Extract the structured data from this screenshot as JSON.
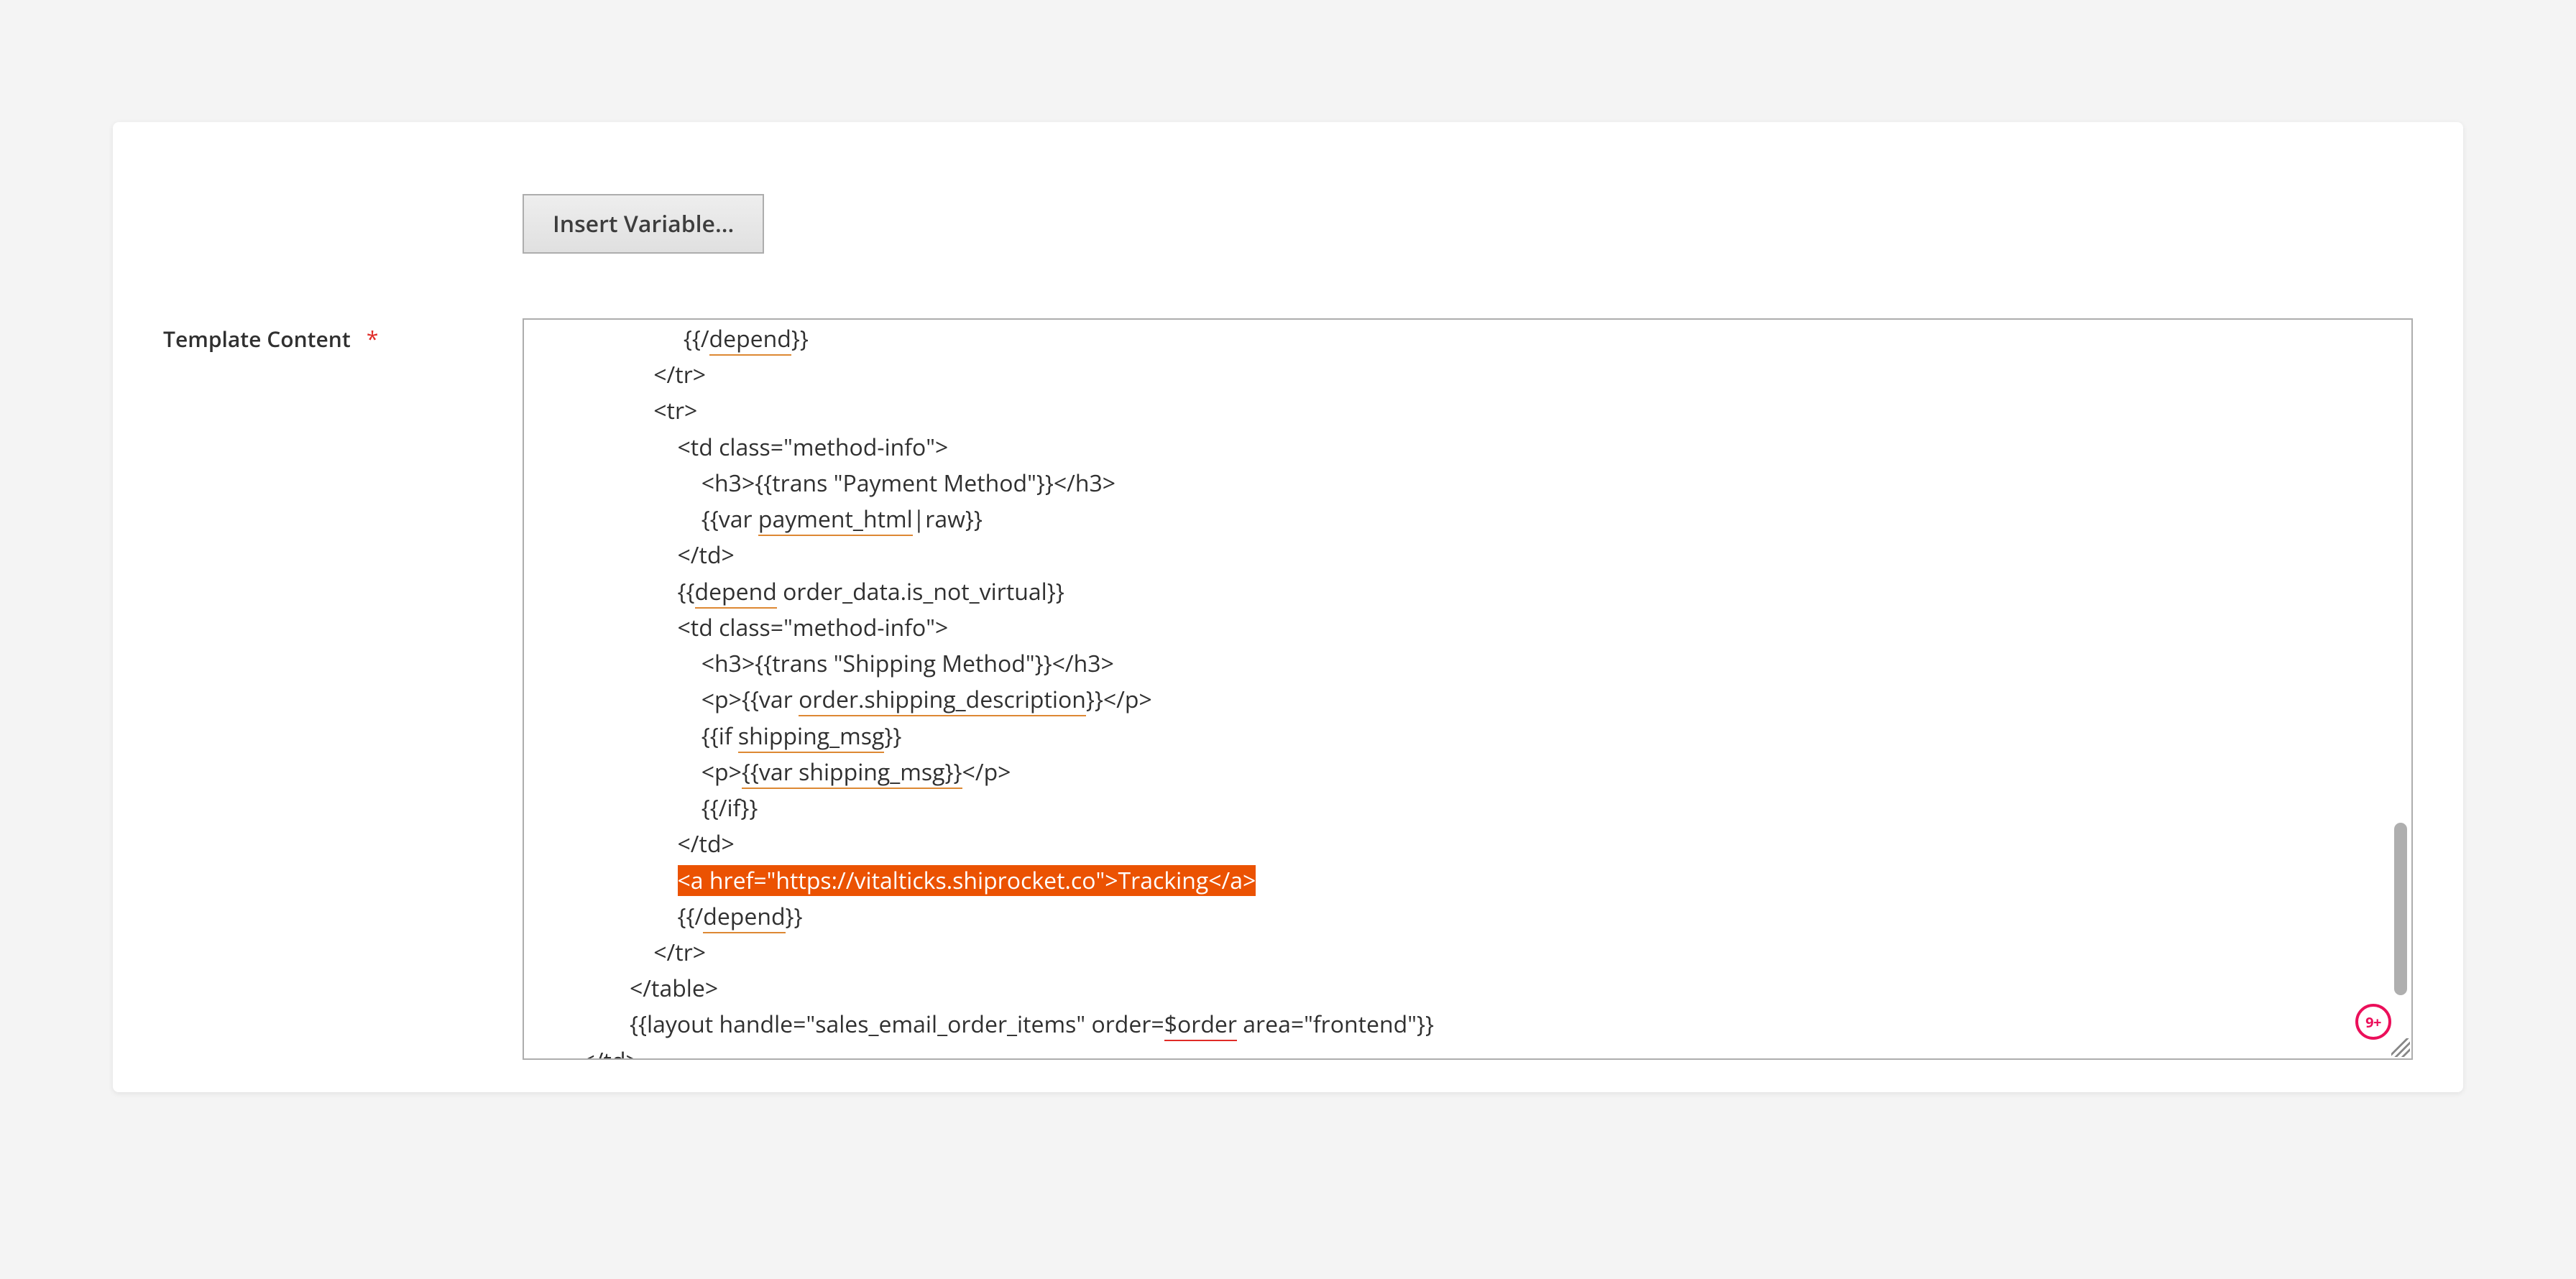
{
  "form": {
    "label": "Template Content",
    "required_mark": "*",
    "insert_variable_button": "Insert Variable..."
  },
  "code": {
    "indent1": "                         ",
    "indent2": "                    ",
    "indent3": "                    ",
    "indent4": "                        ",
    "indent5": "                            ",
    "indent6": "                ",
    "indent7": "                ",
    "indent8": "        ",
    "l1a": "{{/",
    "l1b": "depend",
    "l1c": "}}",
    "l2": "</tr>",
    "l3": "<tr>",
    "l4": "<td class=\"method-info\">",
    "l5": "<h3>{{trans \"Payment Method\"}}</h3>",
    "l6a": "{{var ",
    "l6b": "payment_html",
    "l6c": "|raw}}",
    "l7": "</td>",
    "l8a": "{{",
    "l8b": "depend",
    "l8c": " order_data.is_not_virtual}}",
    "l9": "<td class=\"method-info\">",
    "l10": "<h3>{{trans \"Shipping Method\"}}</h3>",
    "l11a": "<p>{{var ",
    "l11b": "order.shipping_description",
    "l11c": "}}</p>",
    "l12a": "{{if ",
    "l12b": "shipping_msg",
    "l12c": "}}",
    "l13a": "<p>",
    "l13b": "{{var shipping_msg}}",
    "l13c": "</p>",
    "l14": "{{/if}}",
    "l15": "</td>",
    "l16": "<a href=\"https://vitalticks.shiprocket.co\">Tracking</a>",
    "l17a": "{{/",
    "l17b": "depend",
    "l17c": "}}",
    "l18": "</tr>",
    "l19": "</table>",
    "l20a": "{{layout handle=\"sales_email_order_items\" order=",
    "l20b": "$order",
    "l20c": " area=\"frontend\"}}",
    "l21": "</td>"
  },
  "badge": {
    "count": "9+"
  }
}
